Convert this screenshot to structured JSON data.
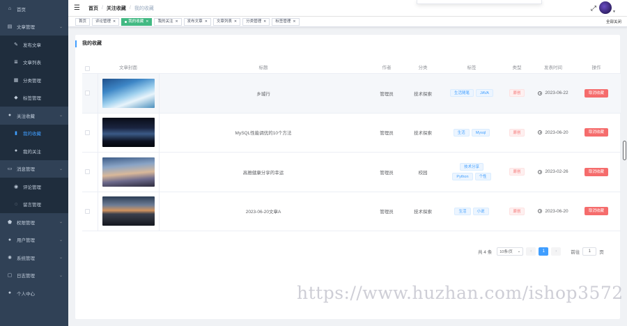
{
  "sidebar": {
    "items": [
      {
        "label": "首页",
        "icon": "home-icon",
        "type": "top",
        "expandable": false,
        "active": false
      },
      {
        "label": "文章管理",
        "icon": "document-icon",
        "type": "top",
        "expandable": true,
        "active": false
      },
      {
        "label": "发布文章",
        "icon": "edit-icon",
        "type": "sub",
        "expandable": false,
        "active": false
      },
      {
        "label": "文章列表",
        "icon": "list-icon",
        "type": "sub",
        "expandable": false,
        "active": false
      },
      {
        "label": "分类管理",
        "icon": "grid-icon",
        "type": "sub",
        "expandable": false,
        "active": false
      },
      {
        "label": "标签管理",
        "icon": "tag-icon",
        "type": "sub",
        "expandable": false,
        "active": false
      },
      {
        "label": "关注收藏",
        "icon": "user-icon",
        "type": "top",
        "expandable": true,
        "active": false
      },
      {
        "label": "我的收藏",
        "icon": "bookmark-icon",
        "type": "sub",
        "expandable": false,
        "active": true
      },
      {
        "label": "我的关注",
        "icon": "person-icon",
        "type": "sub",
        "expandable": false,
        "active": false
      },
      {
        "label": "消息管理",
        "icon": "message-icon",
        "type": "top",
        "expandable": true,
        "active": false
      },
      {
        "label": "评论管理",
        "icon": "comment-icon",
        "type": "sub",
        "expandable": false,
        "active": false
      },
      {
        "label": "留言管理",
        "icon": "chat-icon",
        "type": "sub",
        "expandable": false,
        "active": false
      },
      {
        "label": "权限管理",
        "icon": "shield-icon",
        "type": "top",
        "expandable": true,
        "active": false
      },
      {
        "label": "用户管理",
        "icon": "users-icon",
        "type": "top",
        "expandable": true,
        "active": false
      },
      {
        "label": "系统管理",
        "icon": "gear-icon",
        "type": "top",
        "expandable": true,
        "active": false
      },
      {
        "label": "日志管理",
        "icon": "log-icon",
        "type": "top",
        "expandable": true,
        "active": false
      },
      {
        "label": "个人中心",
        "icon": "profile-icon",
        "type": "top",
        "expandable": false,
        "active": false
      }
    ]
  },
  "header": {
    "breadcrumb": [
      "首页",
      "关注收藏",
      "我的收藏"
    ]
  },
  "tags": [
    {
      "label": "首页",
      "active": false,
      "closable": false
    },
    {
      "label": "评论管理",
      "active": false,
      "closable": true
    },
    {
      "label": "我的收藏",
      "active": true,
      "closable": true
    },
    {
      "label": "我的关注",
      "active": false,
      "closable": true
    },
    {
      "label": "发布文章",
      "active": false,
      "closable": true
    },
    {
      "label": "文章列表",
      "active": false,
      "closable": true
    },
    {
      "label": "分类管理",
      "active": false,
      "closable": true
    },
    {
      "label": "标签管理",
      "active": false,
      "closable": true
    }
  ],
  "tags_close_all": "全部关闭",
  "card_title": "我的收藏",
  "table": {
    "columns": [
      "文章封面",
      "标题",
      "作者",
      "分类",
      "标签",
      "类型",
      "发表时间",
      "操作"
    ],
    "rows": [
      {
        "title": "乡城行",
        "author": "管理员",
        "category": "技术探索",
        "tags": [
          "生活随笔",
          "JAVA"
        ],
        "type": "原创",
        "date": "2023-06-22",
        "action": "取消收藏",
        "cover": "linear-gradient(160deg,#1f4f8a 0%,#3d86c6 30%,#9ed0ee 55%,#e8f4fb 70%,#4a8fbd 100%)",
        "highlight": true
      },
      {
        "title": "MySQL性能调优的10个方法",
        "author": "管理员",
        "category": "技术探索",
        "tags": [
          "生活",
          "Mysql"
        ],
        "type": "原创",
        "date": "2023-06-20",
        "action": "取消收藏",
        "cover": "linear-gradient(180deg,#0a0d18 0%,#1a2440 35%,#3b5a86 55%,#0d1222 80%,#05070c 100%)",
        "highlight": false
      },
      {
        "title": "高雅健康分享的幸运",
        "author": "管理员",
        "category": "校园",
        "tags": [
          "技术分享",
          "Python",
          "个性"
        ],
        "type": "原创",
        "date": "2023-02-26",
        "action": "取消收藏",
        "cover": "linear-gradient(175deg,#3c5b86 0%,#8aa4c6 30%,#d9b899 55%,#6d6a8c 75%,#2d2b3d 100%)",
        "highlight": false
      },
      {
        "title": "2023-06-20文章A",
        "author": "管理员",
        "category": "技术探索",
        "tags": [
          "生活",
          "小说"
        ],
        "type": "原创",
        "date": "2023-06-20",
        "action": "取消收藏",
        "cover": "linear-gradient(180deg,#2b3d55 0%,#6e7d95 30%,#d2945e 48%,#3b3f4c 60%,#15181f 100%)",
        "highlight": false
      }
    ]
  },
  "pagination": {
    "total": "共 4 条",
    "page_size": "10条/页",
    "current_page": "1",
    "goto_label": "前往",
    "goto_value": "1",
    "page_suffix": "页"
  },
  "watermark": "https://www.huzhan.com/ishop3572",
  "colors": {
    "sidebar_bg": "#304156",
    "accent": "#409eff",
    "active_tag": "#42b983",
    "danger": "#f56c6c"
  }
}
